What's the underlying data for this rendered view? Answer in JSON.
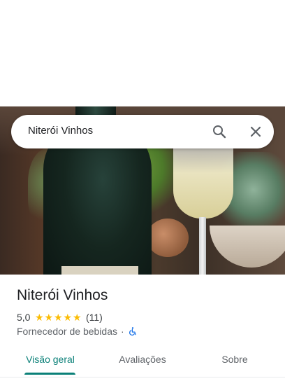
{
  "search": {
    "query": "Niterói Vinhos"
  },
  "place": {
    "name": "Niterói Vinhos",
    "rating": "5,0",
    "stars": 5,
    "review_count": "(11)",
    "category": "Fornecedor de bebidas",
    "separator": "·",
    "accessibility_icon": "wheelchair-icon"
  },
  "tabs": [
    {
      "label": "Visão geral",
      "active": true
    },
    {
      "label": "Avaliações",
      "active": false
    },
    {
      "label": "Sobre",
      "active": false
    }
  ],
  "colors": {
    "accent": "#0b8078",
    "star": "#fbbc04",
    "accessibility": "#1a73e8"
  },
  "icons": {
    "search": "search-icon",
    "close": "close-icon"
  }
}
